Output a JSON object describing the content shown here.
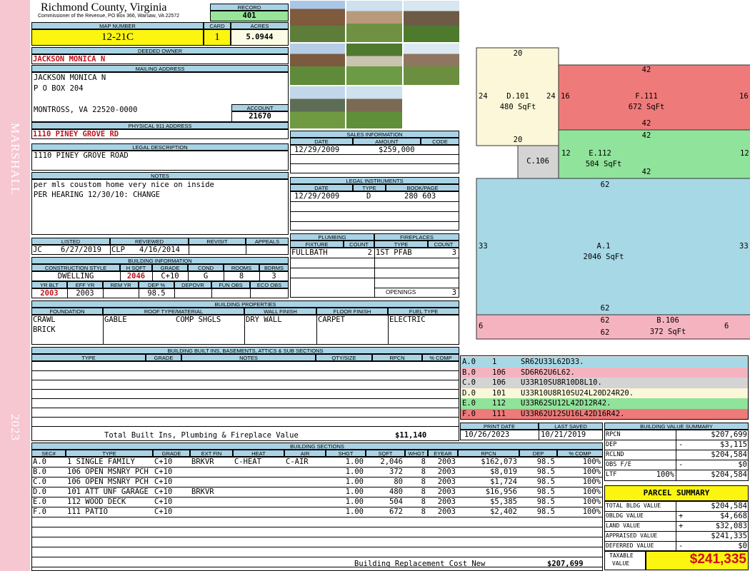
{
  "sidebar": {
    "district": "MARSHALL",
    "year": "2023"
  },
  "header": {
    "county": "Richmond County, Virginia",
    "commissioner": "Commissioner of the Revenue, PO Box 366, Warsaw, VA 22572",
    "record_label": "RECORD",
    "record": "401",
    "map_number_label": "MAP NUMBER",
    "map_number": "12-21C",
    "card_label": "CARD",
    "card": "1",
    "acres_label": "ACRES",
    "acres": "5.0944"
  },
  "owner": {
    "deeded_label": "DEEDED OWNER",
    "deeded": "JACKSON MONICA N",
    "mailing_label": "MAILING ADDRESS",
    "mail1": "JACKSON MONICA N",
    "mail2": "P O BOX 204",
    "mail3": "MONTROSS, VA 22520-0000",
    "account_label": "ACCOUNT",
    "account": "21670",
    "physical_label": "PHYSICAL 911 ADDRESS",
    "physical": "1110 PINEY GROVE RD",
    "legal_label": "LEGAL DESCRIPTION",
    "legal": "1110 PINEY GROVE ROAD",
    "notes_label": "NOTES",
    "notes1": "per mls coustom home very nice on inside",
    "notes2": "PER HEARING 12/30/10: CHANGE"
  },
  "review": {
    "listed_label": "LISTED",
    "reviewed_label": "REVIEWED",
    "revisit_label": "REVISIT",
    "appeals_label": "APPEALS",
    "listed_by": "JC",
    "listed_date": "6/27/2019",
    "reviewed_by": "CLP",
    "reviewed_date": "4/16/2014"
  },
  "building_info": {
    "label": "BUILDING INFORMATION",
    "h": [
      "CONSTRUCTION STYLE",
      "H SQFT",
      "GRADE",
      "COND",
      "ROOMS",
      "BDRMS"
    ],
    "v": [
      "DWELLING",
      "2046",
      "C+10",
      "G",
      "8",
      "3"
    ],
    "h2": [
      "YR BLT",
      "EFF YR",
      "REM YR",
      "DEP %",
      "DEPOVR",
      "FUN OBS",
      "ECO OBS"
    ],
    "v2": [
      "2003",
      "2003",
      "",
      "98.5",
      "",
      "",
      ""
    ]
  },
  "sales": {
    "label": "SALES INFORMATION",
    "h": [
      "DATE",
      "AMOUNT",
      "CODE"
    ],
    "date": "12/29/2009",
    "amount": "$259,000",
    "code": ""
  },
  "legal_instruments": {
    "label": "LEGAL INSTRUMENTS",
    "h": [
      "DATE",
      "TYPE",
      "BOOK/PAGE"
    ],
    "date": "12/29/2009",
    "type": "D",
    "bookpage": "280 603"
  },
  "plumbing": {
    "label": "PLUMBING",
    "h": [
      "FIXTURE",
      "COUNT"
    ],
    "fixture": "FULLBATH",
    "count": "2"
  },
  "fireplaces": {
    "label": "FIREPLACES",
    "h": [
      "TYPE",
      "COUNT"
    ],
    "type": "1ST PFAB",
    "count": "3",
    "openings_label": "OPENINGS",
    "openings": "3"
  },
  "properties": {
    "label": "BUILDING PROPERTIES",
    "h": [
      "FOUNDATION",
      "ROOF TYPE/MATERIAL",
      "WALL FINISH",
      "FLOOR FINISH",
      "FUEL TYPE"
    ],
    "foundation1": "CRAWL",
    "foundation2": "BRICK",
    "roof_type": "GABLE",
    "roof_mat": "COMP SHGLS",
    "wall": "DRY WALL",
    "floor": "CARPET",
    "fuel": "ELECTRIC"
  },
  "builtins": {
    "label": "BUILDING BUILT INS, BASEMENTS, ATTICS & SUB SECTIONS",
    "h": [
      "TYPE",
      "GRADE",
      "NOTES",
      "QTY/SIZE",
      "RPCN",
      "% COMP"
    ],
    "total_label": "Total Built Ins, Plumbing & Fireplace Value",
    "total": "$11,140"
  },
  "sketch": {
    "D": {
      "label": "D.101",
      "area": "480 SqFt",
      "top": "20",
      "bottom": "20",
      "left": "24",
      "right": "24"
    },
    "F": {
      "label": "F.111",
      "area": "672 SqFt",
      "top": "42",
      "bottom": "42",
      "left": "16",
      "right": "16"
    },
    "E": {
      "label": "E.112",
      "area": "504 SqFt",
      "top": "42",
      "bottom": "42",
      "left": "12",
      "right": "12"
    },
    "C": {
      "label": "C.106"
    },
    "A": {
      "label": "A.1",
      "area": "2046 SqFt",
      "top": "62",
      "bottom": "62",
      "left": "33",
      "right": "33"
    },
    "B": {
      "label": "B.106",
      "area": "372 SqFt",
      "top": "62",
      "bottom": "62",
      "left": "6",
      "right": "6"
    },
    "colors": {
      "D": "#fbf7d8",
      "F": "#ef7a7a",
      "E": "#90e39a",
      "C": "#d4d4d4",
      "A": "#a7d8e6",
      "B": "#f5b3c0"
    }
  },
  "vectors": [
    {
      "sec": "A.0",
      "code": "1",
      "vec": "SR62U33L62D33.",
      "color": "#a7d8e6"
    },
    {
      "sec": "B.0",
      "code": "106",
      "vec": "SD6R62U6L62.",
      "color": "#f5b3c0"
    },
    {
      "sec": "C.0",
      "code": "106",
      "vec": "U33R10SU8R10D8L10.",
      "color": "#d4d4d4"
    },
    {
      "sec": "D.0",
      "code": "101",
      "vec": "U33R10U8R10SU24L20D24R20.",
      "color": "#fbf7d8"
    },
    {
      "sec": "E.0",
      "code": "112",
      "vec": "U33R62SU12L42D12R42.",
      "color": "#90e39a"
    },
    {
      "sec": "F.0",
      "code": "111",
      "vec": "U33R62U12SU16L42D16R42.",
      "color": "#ef7a7a"
    }
  ],
  "print": {
    "print_label": "PRINT DATE",
    "saved_label": "LAST SAVED",
    "print_date": "10/26/2023",
    "saved_date": "10/21/2019"
  },
  "sections": {
    "label": "BUILDING SECTIONS",
    "h": [
      "SEC#",
      "TYPE",
      "GRADE",
      "EXT FIN",
      "HEAT",
      "AIR",
      "SHGT",
      "SQFT",
      "WHGT",
      "EYEAR",
      "RPCN",
      "DEP",
      "% COMP"
    ],
    "rows": [
      [
        "A.0",
        "1 SINGLE FAMILY",
        "C+10",
        "BRKVR",
        "C-HEAT",
        "C-AIR",
        "1.00",
        "2,046",
        "8",
        "2003",
        "$162,073",
        "98.5",
        "100%"
      ],
      [
        "B.0",
        "106 OPEN MSNRY PCH",
        "C+10",
        "",
        "",
        "",
        "1.00",
        "372",
        "8",
        "2003",
        "$8,019",
        "98.5",
        "100%"
      ],
      [
        "C.0",
        "106 OPEN MSNRY PCH",
        "C+10",
        "",
        "",
        "",
        "1.00",
        "80",
        "8",
        "2003",
        "$1,724",
        "98.5",
        "100%"
      ],
      [
        "D.0",
        "101 ATT UNF GARAGE",
        "C+10",
        "BRKVR",
        "",
        "",
        "1.00",
        "480",
        "8",
        "2003",
        "$16,956",
        "98.5",
        "100%"
      ],
      [
        "E.0",
        "112 WOOD DECK",
        "C+10",
        "",
        "",
        "",
        "1.00",
        "504",
        "8",
        "2003",
        "$5,385",
        "98.5",
        "100%"
      ],
      [
        "F.0",
        "111 PATIO",
        "C+10",
        "",
        "",
        "",
        "1.00",
        "672",
        "8",
        "2003",
        "$2,402",
        "98.5",
        "100%"
      ]
    ],
    "total_label": "Building Replacement Cost New",
    "total": "$207,699"
  },
  "value_summary": {
    "label": "BUILDING VALUE SUMMARY",
    "rpcn_l": "RPCN",
    "rpcn": "$207,699",
    "dep_l": "DEP",
    "dep_sign": "-",
    "dep": "$3,115",
    "rclnd_l": "RCLND",
    "rclnd": "$204,584",
    "obs_l": "OBS F/E",
    "obs_sign": "-",
    "obs": "$0",
    "ltf_l": "LTF",
    "ltf_pct": "100%",
    "ltf": "$204,584"
  },
  "parcel": {
    "title": "PARCEL SUMMARY",
    "bldg_l": "TOTAL BLDG VALUE",
    "bldg": "$204,584",
    "obldg_l": "OBLDG VALUE",
    "obldg_sign": "+",
    "obldg": "$4,668",
    "land_l": "LAND VALUE",
    "land_sign": "+",
    "land": "$32,083",
    "appraised_l": "APPRAISED VALUE",
    "appraised": "$241,335",
    "deferred_l": "DEFERRED VALUE",
    "deferred_sign": "-",
    "deferred": "$0",
    "taxable_l1": "TAXABLE",
    "taxable_l2": "VALUE",
    "taxable": "$241,335"
  }
}
